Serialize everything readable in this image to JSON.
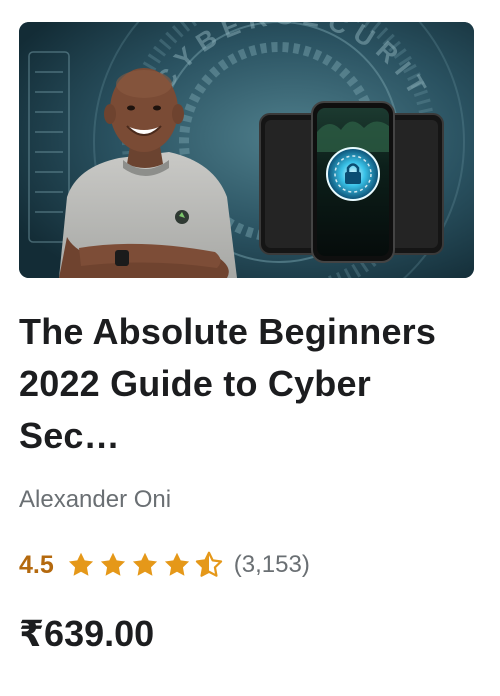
{
  "course": {
    "title": "The Absolute Beginners 2022 Guide to Cyber Sec…",
    "instructor": "Alexander Oni",
    "rating": "4.5",
    "rating_count": "(3,153)",
    "price": "₹639.00",
    "star_count": 5,
    "stars_filled": 4.5
  },
  "thumbnail": {
    "overlay_text": "CYBERSECURITY"
  },
  "colors": {
    "rating_accent": "#b4690e",
    "star": "#e59819",
    "text": "#1c1d1f",
    "muted": "#6a6f73",
    "thumb_bg": "#1f3d48"
  }
}
